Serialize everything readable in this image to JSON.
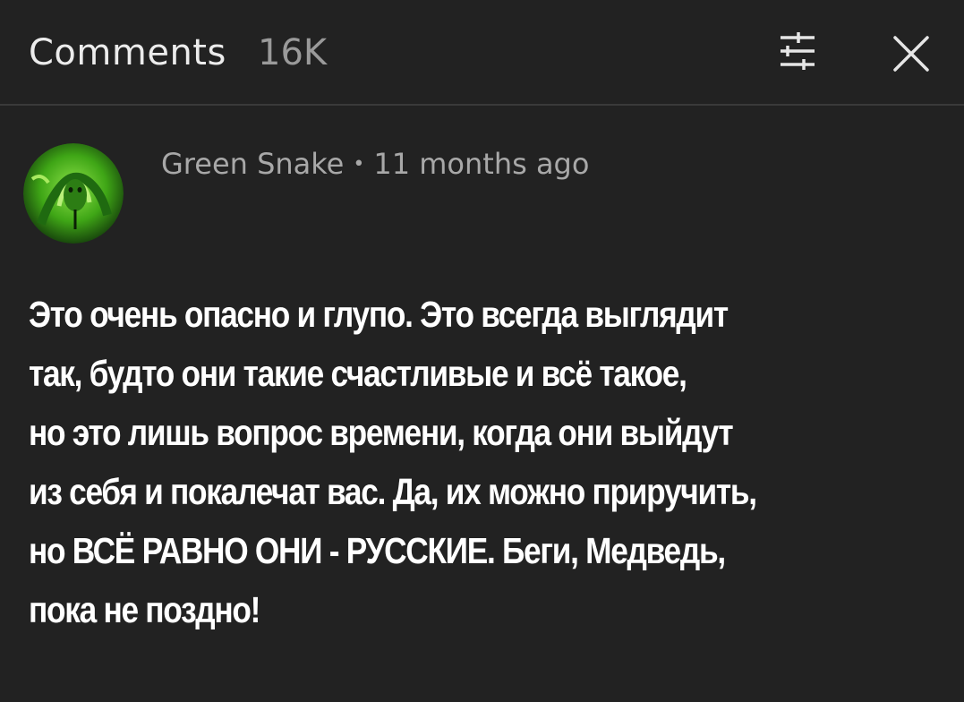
{
  "header": {
    "title": "Comments",
    "count": "16K",
    "sort_icon": "sort-filter-icon",
    "close_icon": "close-icon"
  },
  "comment": {
    "author": "Green Snake",
    "separator": "•",
    "timestamp": "11 months ago",
    "avatar_icon": "green-snake-avatar",
    "lines": [
      "Это очень опасно и глупо. Это всегда выглядит",
      "так, будто они такие счастливые и всё такое,",
      "но это лишь вопрос времени, когда они выйдут",
      "из себя и покалечат вас. Да, их можно приручить,",
      "но ВСЁ РАВНО ОНИ - РУССКИЕ. Беги, Медведь,",
      "пока не поздно!"
    ]
  },
  "colors": {
    "background": "#222222",
    "text": "#ffffff",
    "muted": "#a8a8a8",
    "divider": "#3a3a3a",
    "avatar_green": "#4fbf1f"
  }
}
